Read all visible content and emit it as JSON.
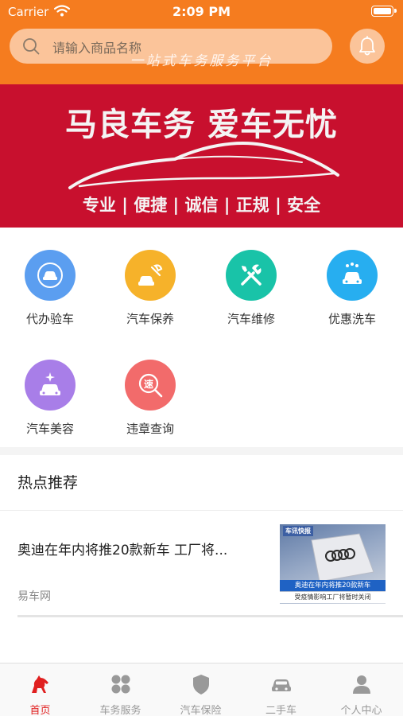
{
  "status_bar": {
    "carrier": "Carrier",
    "time": "2:09 PM"
  },
  "header": {
    "search_placeholder": "请输入商品名称",
    "slogan": "一站式车务服务平台",
    "accent_color": "#f57c1f"
  },
  "banner": {
    "headline": "马良车务  爱车无忧",
    "tags": "专业 | 便捷 | 诚信 | 正规 | 安全",
    "color": "#c8102e"
  },
  "services": [
    {
      "label": "代办验车",
      "icon": "car-inspection-icon",
      "color": "#5b9ef0"
    },
    {
      "label": "汽车保养",
      "icon": "car-maintenance-icon",
      "color": "#f6b22a"
    },
    {
      "label": "汽车维修",
      "icon": "repair-tools-icon",
      "color": "#19c3a8"
    },
    {
      "label": "优惠洗车",
      "icon": "car-wash-icon",
      "color": "#27aef0"
    },
    {
      "label": "汽车美容",
      "icon": "car-beauty-icon",
      "color": "#a87ee8"
    },
    {
      "label": "违章查询",
      "icon": "violation-search-icon",
      "color": "#f26b6b"
    }
  ],
  "hot": {
    "title": "热点推荐",
    "items": [
      {
        "title": "奥迪在年内将推20款新车 工厂将...",
        "source": "易车网",
        "thumb_badge": "车讯快报",
        "thumb_caption1": "奥迪在年内将推20款新车",
        "thumb_caption2": "受疫情影响工厂将暂时关闭"
      }
    ]
  },
  "tabbar": [
    {
      "label": "首页",
      "icon": "horse-icon",
      "active": true
    },
    {
      "label": "车务服务",
      "icon": "grid-icon",
      "active": false
    },
    {
      "label": "汽车保险",
      "icon": "shield-icon",
      "active": false
    },
    {
      "label": "二手车",
      "icon": "car-icon",
      "active": false
    },
    {
      "label": "个人中心",
      "icon": "user-icon",
      "active": false
    }
  ]
}
